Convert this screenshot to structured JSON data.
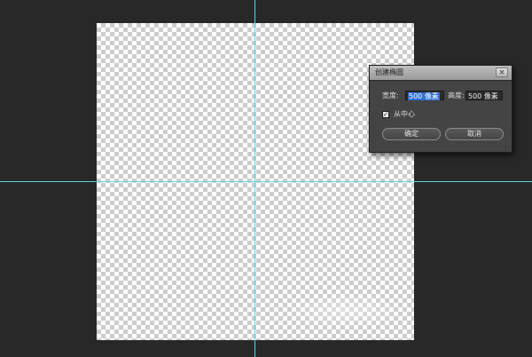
{
  "dialog": {
    "title": "创建椭圆",
    "close_symbol": "×",
    "width_label": "宽度:",
    "width_value": "500 像素",
    "height_label": "高度:",
    "height_value": "500 像素",
    "from_center_label": "从中心",
    "from_center_checked": true,
    "check_symbol": "✓",
    "ok_label": "确定",
    "cancel_label": "取消"
  },
  "colors": {
    "workspace_bg": "#282828",
    "guide": "#5fd3e0",
    "selection": "#2f6fd4"
  }
}
